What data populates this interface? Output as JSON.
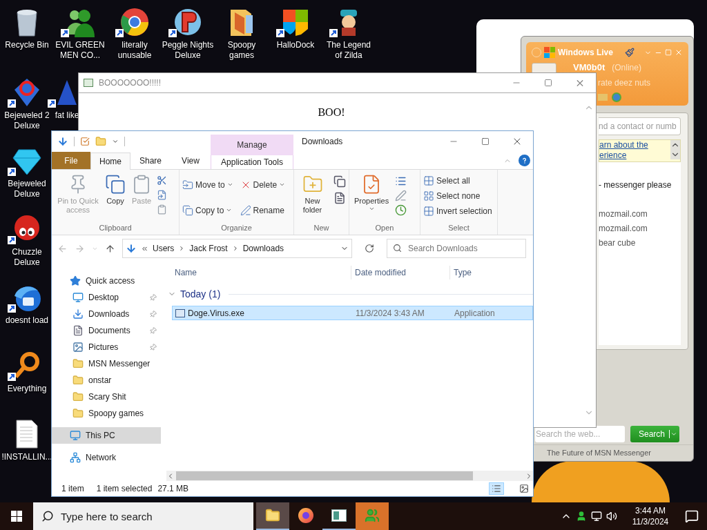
{
  "desktop_icons": [
    {
      "label": "Recycle Bin",
      "shortcut": false
    },
    {
      "label": "EVIL GREEN MEN CO...",
      "shortcut": true
    },
    {
      "label": "literally unusable",
      "shortcut": true
    },
    {
      "label": "Peggle Nights Deluxe",
      "shortcut": true
    },
    {
      "label": "Spoopy games",
      "shortcut": false
    },
    {
      "label": "HalloDock",
      "shortcut": true
    },
    {
      "label": "The Legend of Zilda",
      "shortcut": true
    },
    {
      "label": "Bejeweled 2 Deluxe",
      "shortcut": true
    },
    {
      "label": "fat like",
      "shortcut": true
    },
    {
      "label": "Bejeweled Deluxe",
      "shortcut": true
    },
    {
      "label": "Chuzzle Deluxe",
      "shortcut": true
    },
    {
      "label": "doesnt load",
      "shortcut": true
    },
    {
      "label": "Everything",
      "shortcut": true
    },
    {
      "label": "!INSTALLIN...",
      "shortcut": false
    }
  ],
  "msn_window": {
    "brand": "Windows Live",
    "user": "VM0b0t",
    "status": "(Online)",
    "personal_message": "rate deez nuts",
    "contact_search_placeholder": "nd a contact or numb",
    "banner_link": [
      "arn about the",
      "erience"
    ],
    "contacts": [
      "- messenger please",
      "mozmail.com",
      "mozmail.com",
      "bear cube"
    ],
    "web_search_placeholder": "Search the web...",
    "search_button": "Search",
    "footer": "The Future of MSN Messenger"
  },
  "boo_window": {
    "title": "BOOOOOOO!!!!!",
    "body": "BOO!"
  },
  "explorer": {
    "title": "Downloads",
    "context_group": "Manage",
    "tabs": [
      {
        "label": "File",
        "kind": "file",
        "selected": false
      },
      {
        "label": "Home",
        "kind": "tab",
        "selected": true
      },
      {
        "label": "Share",
        "kind": "tab",
        "selected": false
      },
      {
        "label": "View",
        "kind": "tab",
        "selected": false
      },
      {
        "label": "Application Tools",
        "kind": "context",
        "selected": false
      }
    ],
    "ribbon": [
      {
        "label": "Clipboard",
        "commands": [
          {
            "label": "Pin to Quick access",
            "kind": "large",
            "disabled": true,
            "dropdown": false
          },
          {
            "label": "Copy",
            "kind": "large",
            "disabled": false,
            "dropdown": false
          },
          {
            "label": "Paste",
            "kind": "large",
            "disabled": true,
            "dropdown": false
          }
        ]
      },
      {
        "label": "Organize",
        "commands": [
          {
            "label": "Move to",
            "kind": "small",
            "disabled": false,
            "dropdown": true
          },
          {
            "label": "Delete",
            "kind": "small",
            "disabled": false,
            "dropdown": true
          },
          {
            "label": "Copy to",
            "kind": "small",
            "disabled": false,
            "dropdown": true
          },
          {
            "label": "Rename",
            "kind": "small",
            "disabled": false,
            "dropdown": false
          }
        ]
      },
      {
        "label": "New",
        "commands": [
          {
            "label": "New folder",
            "kind": "large",
            "disabled": false,
            "dropdown": false
          }
        ]
      },
      {
        "label": "Open",
        "commands": [
          {
            "label": "Properties",
            "kind": "large",
            "disabled": false,
            "dropdown": true
          }
        ]
      },
      {
        "label": "Select",
        "commands": [
          {
            "label": "Select all",
            "kind": "small",
            "disabled": false,
            "dropdown": false
          },
          {
            "label": "Select none",
            "kind": "small",
            "disabled": false,
            "dropdown": false
          },
          {
            "label": "Invert selection",
            "kind": "small",
            "disabled": false,
            "dropdown": false
          }
        ]
      }
    ],
    "path": [
      "Users",
      "Jack Frost",
      "Downloads"
    ],
    "search_placeholder": "Search Downloads",
    "nav": [
      {
        "label": "Quick access",
        "kind": "quick",
        "selected": false,
        "children": [
          {
            "label": "Desktop",
            "kind": "desktop",
            "pinned": true,
            "selected": false
          },
          {
            "label": "Downloads",
            "kind": "downloads",
            "pinned": true,
            "selected": false
          },
          {
            "label": "Documents",
            "kind": "documents",
            "pinned": true,
            "selected": false
          },
          {
            "label": "Pictures",
            "kind": "pictures",
            "pinned": true,
            "selected": false
          },
          {
            "label": "MSN Messenger",
            "kind": "folder",
            "pinned": false,
            "selected": false
          },
          {
            "label": "onstar",
            "kind": "folder",
            "pinned": false,
            "selected": false
          },
          {
            "label": "Scary Shit",
            "kind": "folder",
            "pinned": false,
            "selected": false
          },
          {
            "label": "Spoopy games",
            "kind": "folder",
            "pinned": false,
            "selected": false
          }
        ]
      },
      {
        "label": "This PC",
        "kind": "pc",
        "selected": true
      },
      {
        "label": "Network",
        "kind": "network",
        "selected": false
      }
    ],
    "columns": [
      "Name",
      "Date modified",
      "Type"
    ],
    "groups": [
      {
        "label": "Today (1)",
        "expanded": true,
        "rows": [
          {
            "name": "Doge.Virus.exe",
            "date_modified": "11/3/2024 3:43 AM",
            "type": "Application",
            "selected": true
          }
        ]
      }
    ],
    "status": [
      "1 item",
      "1 item selected",
      "27.1 MB"
    ],
    "views": [
      {
        "kind": "details",
        "selected": true
      },
      {
        "kind": "large_icons",
        "selected": false
      }
    ]
  },
  "taskbar": {
    "search_placeholder": "Type here to search",
    "apps": [
      {
        "kind": "explorer",
        "selected": true,
        "open": true,
        "flashing": false
      },
      {
        "kind": "firefox",
        "selected": false,
        "open": false,
        "flashing": false
      },
      {
        "kind": "window",
        "selected": false,
        "open": true,
        "flashing": false
      },
      {
        "kind": "messenger",
        "selected": false,
        "open": false,
        "flashing": true
      }
    ],
    "time": "3:44 AM",
    "date": "11/3/2024"
  }
}
